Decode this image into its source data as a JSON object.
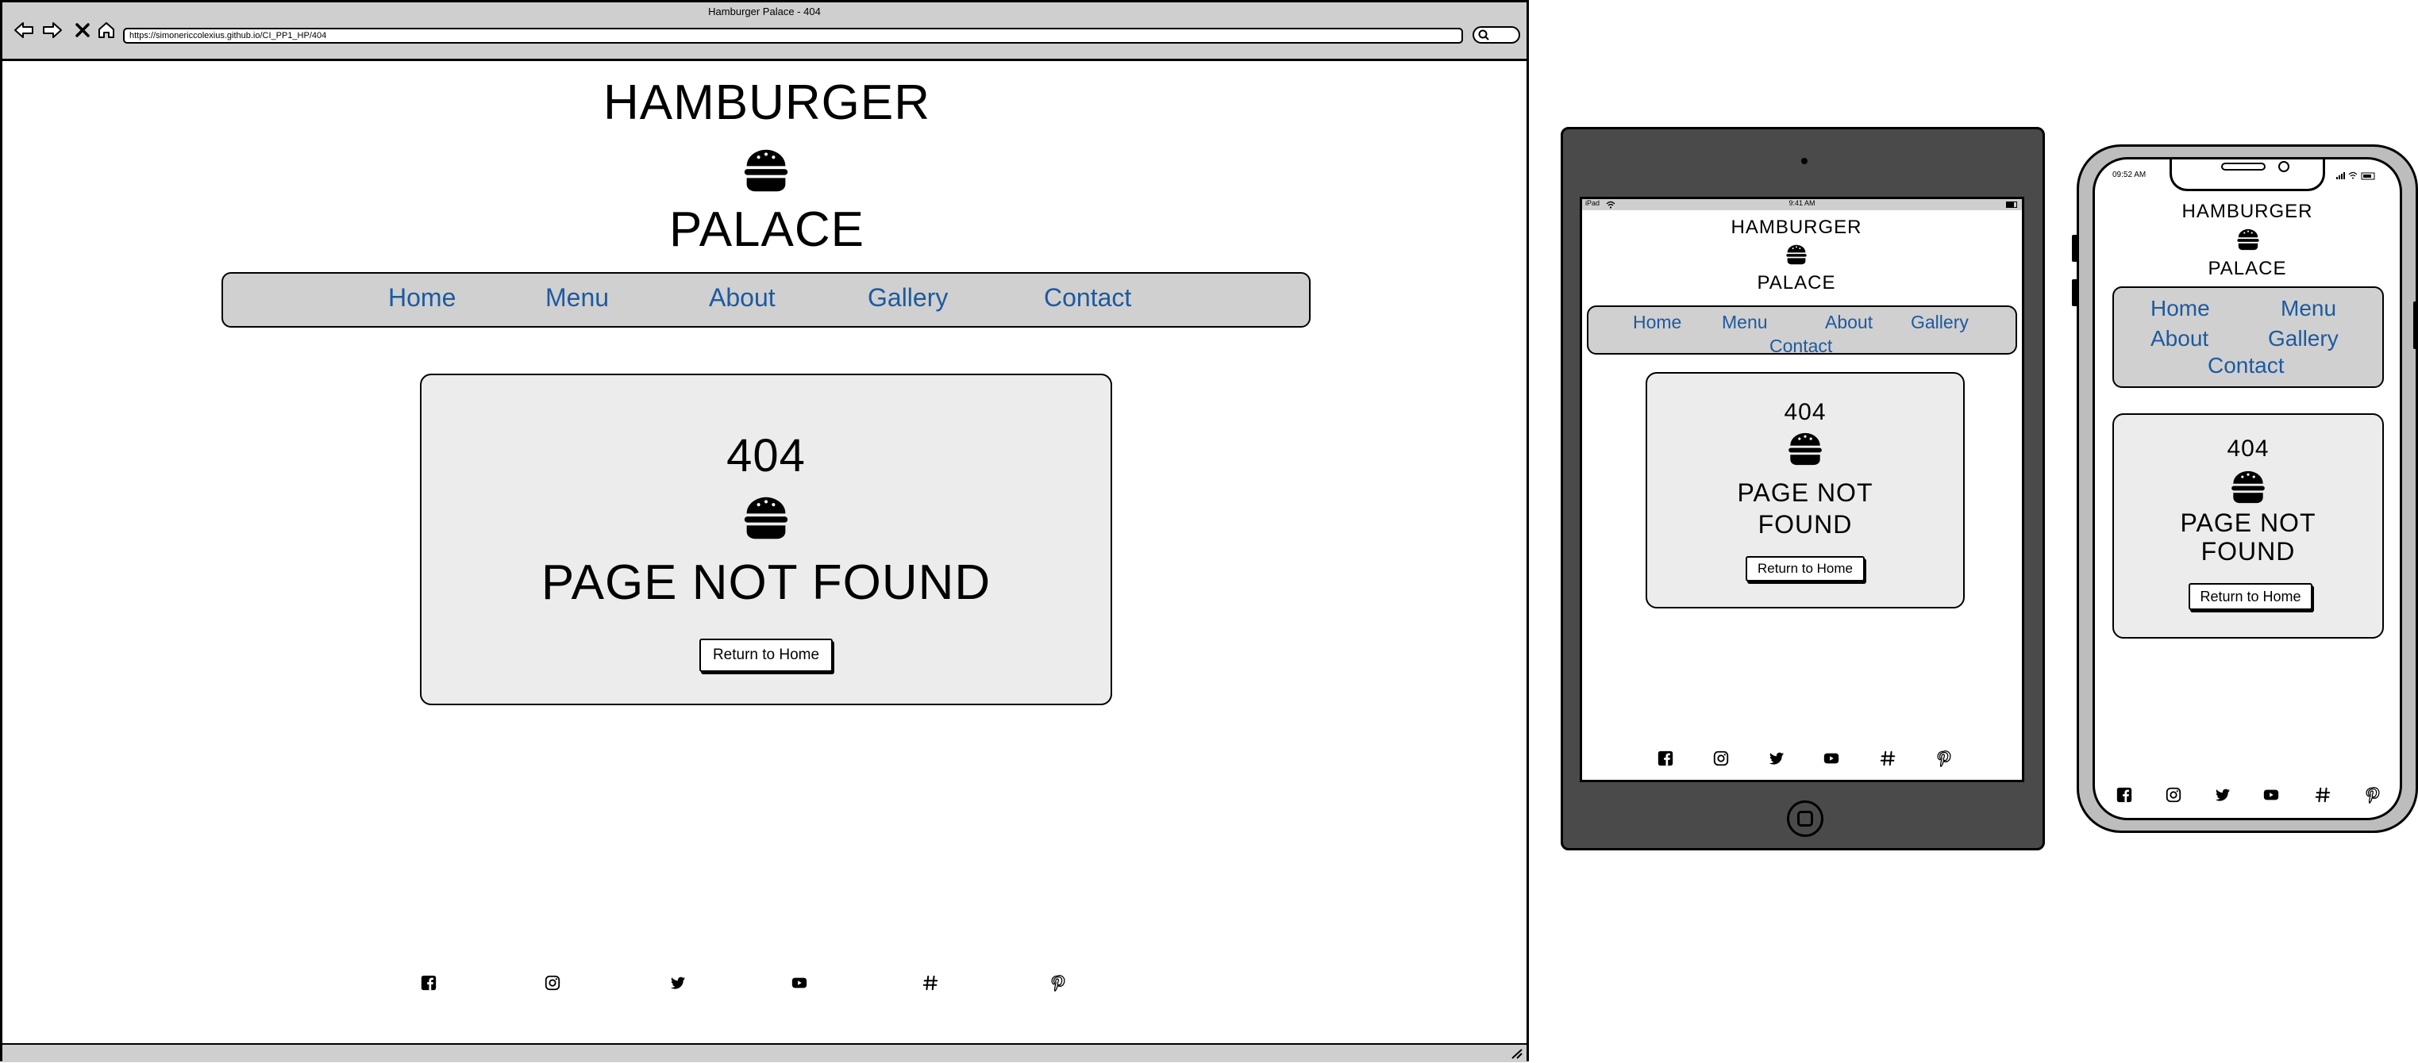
{
  "browser": {
    "title": "Hamburger Palace - 404",
    "url": "https://simonericcolexius.github.io/CI_PP1_HP/404"
  },
  "brand": {
    "line1": "HAMBURGER",
    "line2": "PALACE"
  },
  "nav": {
    "home": "Home",
    "menu": "Menu",
    "about": "About",
    "gallery": "Gallery",
    "contact": "Contact"
  },
  "error": {
    "code": "404",
    "message": "PAGE NOT FOUND",
    "tablet_line1": "PAGE NOT",
    "tablet_line2": "FOUND",
    "button": "Return to Home"
  },
  "social": [
    "facebook-icon",
    "instagram-icon",
    "twitter-icon",
    "youtube-icon",
    "hashtag-icon",
    "pinterest-icon"
  ],
  "tablet": {
    "carrier": "iPad",
    "time": "9:41 AM"
  },
  "phone": {
    "time": "09:52 AM"
  },
  "colors": {
    "link": "#1d5aa0",
    "navbar": "#d0d0d0",
    "card": "#ececec",
    "chrome": "#cfcfcf",
    "tablet_frame": "#4a4a4a",
    "phone_frame": "#bdbdbd"
  }
}
